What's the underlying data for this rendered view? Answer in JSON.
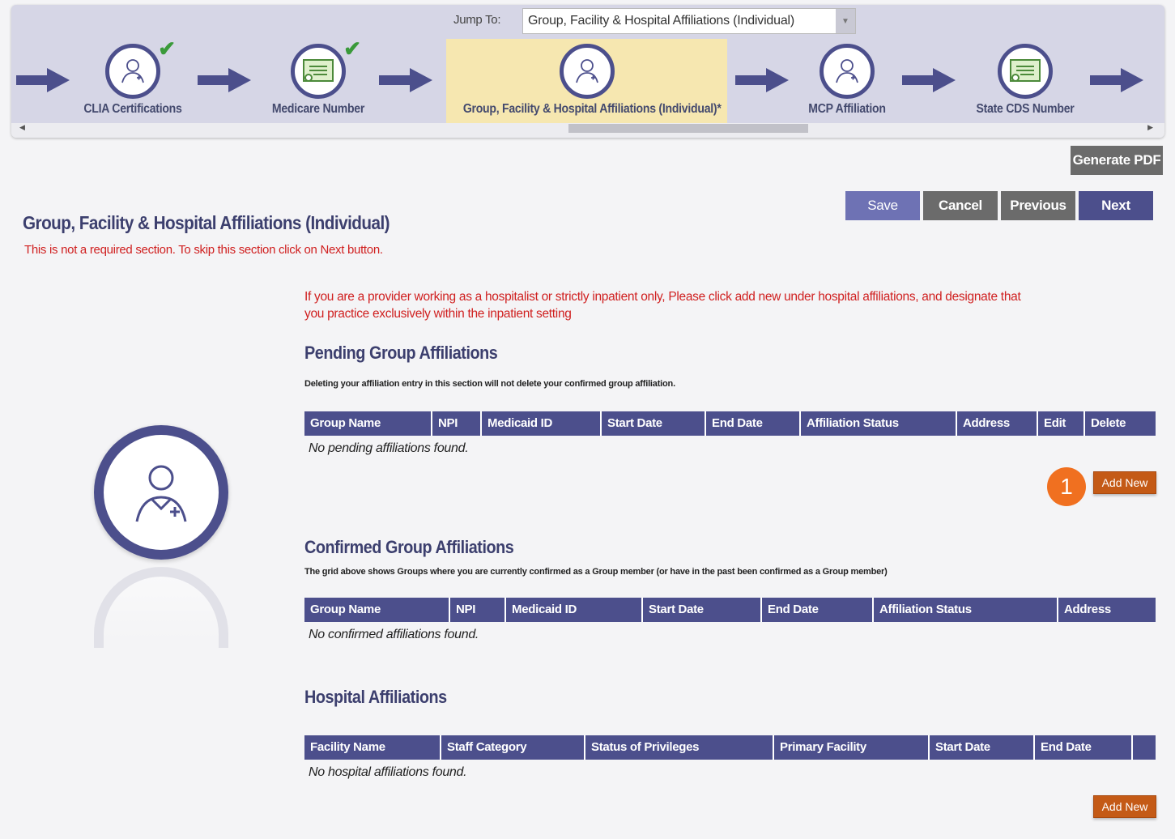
{
  "jump": {
    "label": "Jump To:",
    "value": "Group, Facility & Hospital Affiliations (Individual)"
  },
  "steps": [
    {
      "label": "CLIA Certifications"
    },
    {
      "label": "Medicare Number"
    },
    {
      "label": "Group, Facility & Hospital Affiliations (Individual)*"
    },
    {
      "label": "MCP Affiliation"
    },
    {
      "label": "State CDS Number"
    }
  ],
  "buttons": {
    "generate_pdf": "Generate PDF",
    "save": "Save",
    "cancel": "Cancel",
    "previous": "Previous",
    "next": "Next",
    "add_new": "Add New"
  },
  "page": {
    "title": "Group, Facility & Hospital Affiliations (Individual)",
    "skip_note": "This is not a required section. To skip this section click on Next button.",
    "hospitalist_note": "If you are a provider working as a hospitalist or strictly inpatient only, Please click add new under hospital affiliations, and designate that you practice exclusively within the inpatient setting"
  },
  "pending": {
    "title": "Pending Group Affiliations",
    "note": "Deleting your affiliation entry in this section will not delete your confirmed group affiliation.",
    "columns": [
      "Group Name",
      "NPI",
      "Medicaid ID",
      "Start Date",
      "End Date",
      "Affiliation Status",
      "Address",
      "Edit",
      "Delete"
    ],
    "empty": "No pending affiliations found."
  },
  "confirmed": {
    "title": "Confirmed Group Affiliations",
    "note": "The grid above shows Groups where you are currently confirmed as a Group member (or have in the past been confirmed as a Group member)",
    "columns": [
      "Group Name",
      "NPI",
      "Medicaid ID",
      "Start Date",
      "End Date",
      "Affiliation Status",
      "Address"
    ],
    "empty": "No confirmed affiliations found."
  },
  "hospital": {
    "title": "Hospital Affiliations",
    "columns": [
      "Facility Name",
      "Staff Category",
      "Status of Privileges",
      "Primary Facility",
      "Start Date",
      "End Date",
      ""
    ],
    "empty": "No hospital affiliations found."
  },
  "marker": "1",
  "colors": {
    "brand": "#4c4f8c",
    "accent": "#c45a16",
    "warning_text": "#d02020",
    "active_step": "#f6e7b0"
  },
  "icons": [
    "arrow-right-icon",
    "doctor-icon",
    "certificate-icon",
    "checkmark-icon"
  ]
}
